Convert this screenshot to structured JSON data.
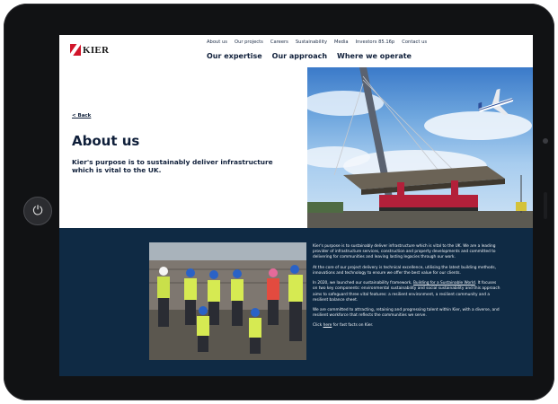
{
  "header": {
    "logo_text": "KIER",
    "nav_top": [
      "About us",
      "Our projects",
      "Careers",
      "Sustainability",
      "Media",
      "Investors 85.16p",
      "Contact us"
    ],
    "nav_main": [
      "Our expertise",
      "Our approach",
      "Where we operate"
    ]
  },
  "hero": {
    "back_label": "< Back",
    "title": "About us",
    "tagline": "Kier's purpose is to sustainably deliver infrastructure which is vital to the UK."
  },
  "content": {
    "para1": "Kier's purpose is to sustainably deliver infrastructure which is vital to the UK. We are a leading provider of infrastructure services, construction and property developments and committed to delivering for communities and leaving lasting legacies through our work.",
    "para2": "At the core of our project delivery is technical excellence, utilising the latest building methods, innovations and technology to ensure we offer the best value for our clients.",
    "para3_before": "In 2020, we launched our sustainability framework, ",
    "para3_link": "Building for a Sustainable World",
    "para3_after": ". It focuses on two key components: environmental sustainability and social sustainability and this approach aims to safeguard three vital features: a resilient environment, a resilient community and a resilient balance sheet.",
    "para4": "We are committed to attracting, retaining and progressing talent within Kier, with a diverse, and resilient workforce that reflects the communities we serve.",
    "para5_before": "Click ",
    "para5_link": "here",
    "para5_after": " for fast facts on Kier."
  },
  "icons": {
    "home_button": "power-icon",
    "logo_mark": "kier-logo-mark"
  },
  "colors": {
    "brand_red": "#d1152a",
    "navy": "#0f2a44",
    "text_dark": "#0f1f3a"
  }
}
